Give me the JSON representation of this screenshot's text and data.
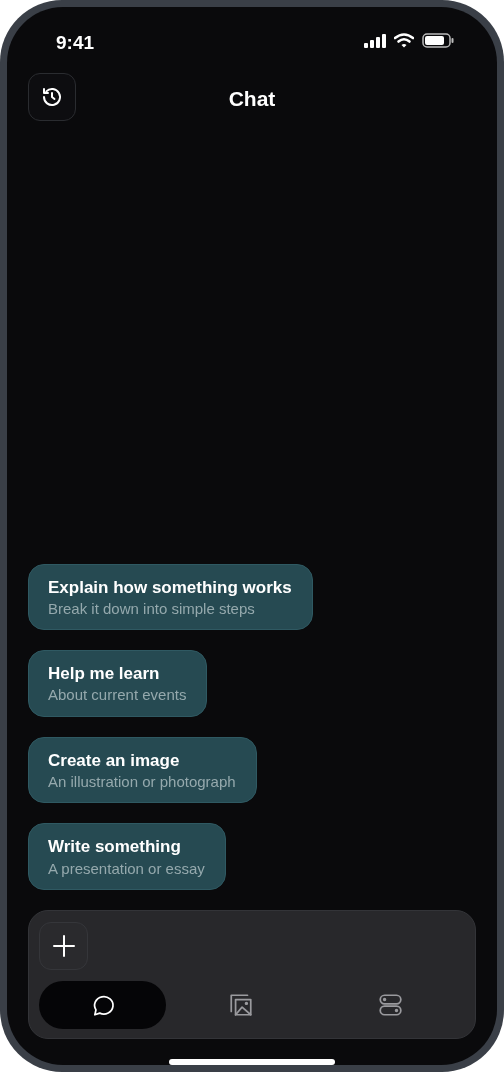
{
  "status_bar": {
    "time": "9:41"
  },
  "header": {
    "title": "Chat"
  },
  "suggestions": [
    {
      "title": "Explain how something works",
      "subtitle": "Break it down into simple steps"
    },
    {
      "title": "Help me learn",
      "subtitle": "About current events"
    },
    {
      "title": "Create an image",
      "subtitle": "An illustration or photograph"
    },
    {
      "title": "Write something",
      "subtitle": "A presentation or essay"
    }
  ],
  "composer": {
    "tabs": [
      {
        "kind": "chat",
        "selected": true
      },
      {
        "kind": "images",
        "selected": false
      },
      {
        "kind": "apps",
        "selected": false
      }
    ]
  }
}
